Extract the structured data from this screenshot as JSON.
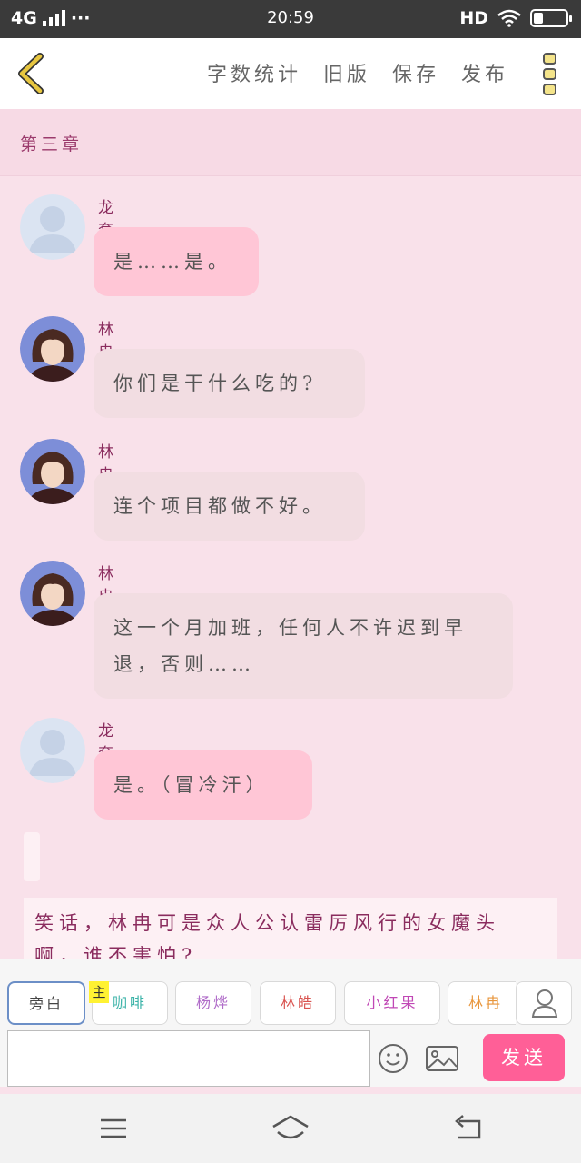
{
  "status_bar": {
    "network": "4G",
    "dots": "···",
    "time": "20:59",
    "hd": "HD",
    "battery_level": 0.3
  },
  "toolbar": {
    "word_count": "字数统计",
    "old_version": "旧版",
    "save": "保存",
    "publish": "发布"
  },
  "chapter": {
    "title": "第三章"
  },
  "messages": [
    {
      "name": "龙套",
      "text": "是……是。",
      "style": "pink",
      "avatar": "default-avatar"
    },
    {
      "name": "林冉",
      "text": "你们是干什么吃的?",
      "style": "gray",
      "avatar": "photo-avatar"
    },
    {
      "name": "林冉",
      "text": "连个项目都做不好。",
      "style": "gray",
      "avatar": "photo-avatar"
    },
    {
      "name": "林冉",
      "text": "这一个月加班，任何人不许迟到早退，否则……",
      "style": "gray",
      "avatar": "photo-avatar"
    },
    {
      "name": "龙套",
      "text": "是。（冒冷汗）",
      "style": "pink",
      "avatar": "default-avatar"
    }
  ],
  "narration": {
    "text": "笑话，林冉可是众人公认雷厉风行的女魔头啊，谁不害怕?"
  },
  "roles": [
    {
      "label": "旁白",
      "color": "#555555"
    },
    {
      "label": "咖啡",
      "color": "#3bb3a8"
    },
    {
      "label": "杨烨",
      "color": "#b06cc9"
    },
    {
      "label": "林皓",
      "color": "#d9534f"
    },
    {
      "label": "小红果",
      "color": "#c047b5"
    },
    {
      "label": "林冉",
      "color": "#e8963c"
    }
  ],
  "role_tag": "主",
  "input": {
    "value": "",
    "placeholder": ""
  },
  "send": {
    "label": "发送"
  },
  "colors": {
    "accent": "#ff5f97",
    "bubble_pink": "#ffc6d6",
    "bubble_gray": "#f2dde2",
    "name": "#8a2c5e",
    "back_arrow": "#e7c640"
  }
}
